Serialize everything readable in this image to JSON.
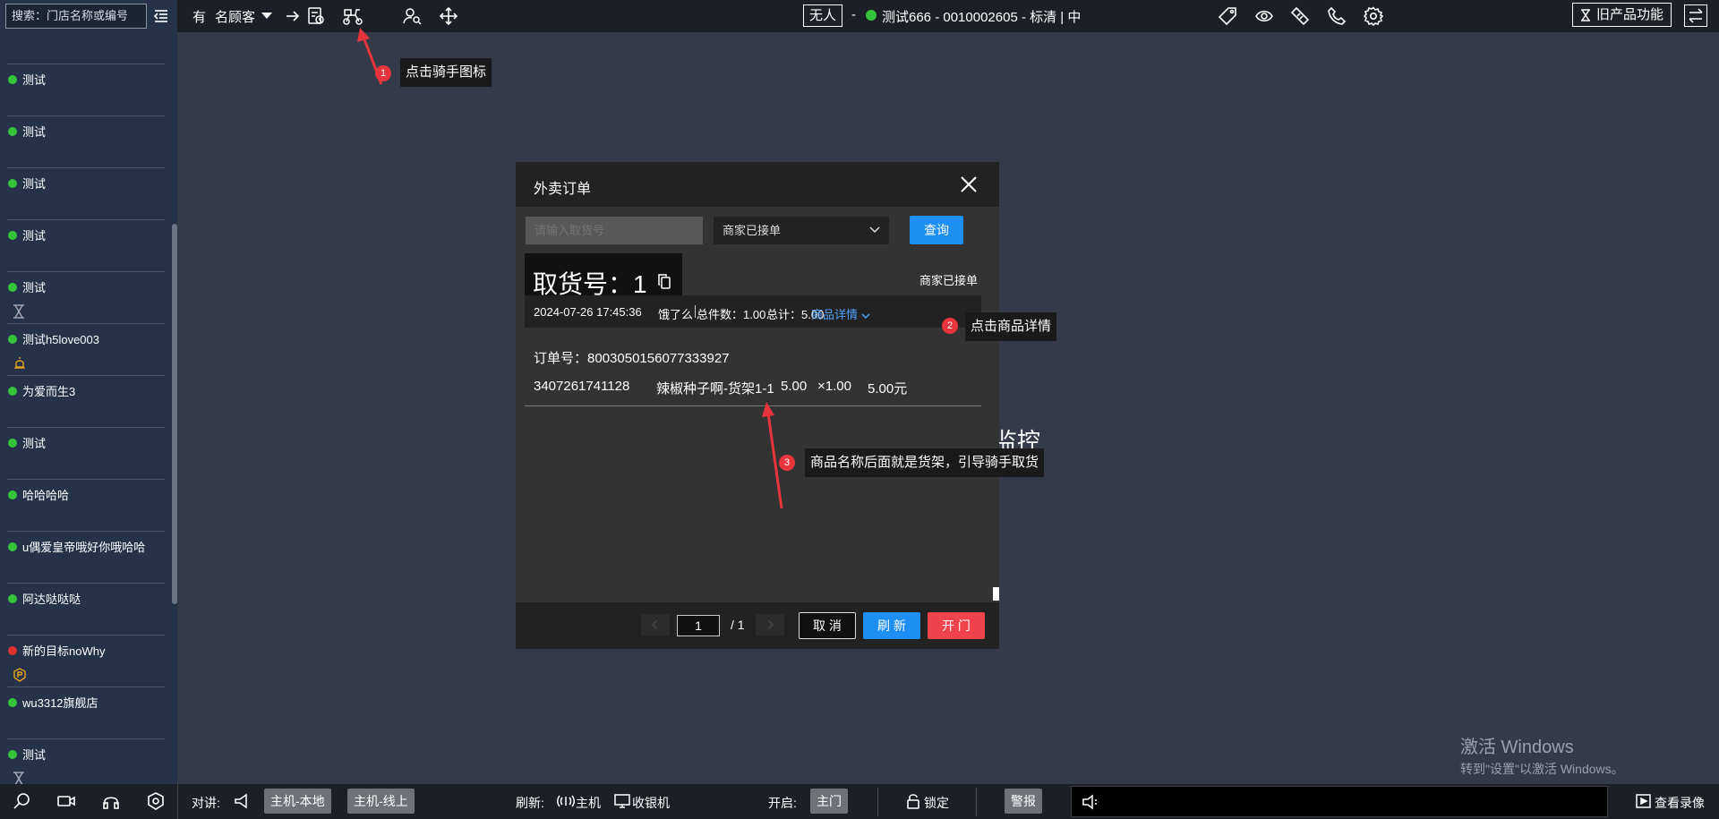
{
  "sidebar": {
    "search_placeholder": "搜索：门店名称或编号",
    "stores": [
      {
        "name": "测试",
        "status_color": "#35c33c",
        "sub_icon": ""
      },
      {
        "name": "测试",
        "status_color": "#35c33c",
        "sub_icon": ""
      },
      {
        "name": "测试",
        "status_color": "#35c33c",
        "sub_icon": ""
      },
      {
        "name": "测试",
        "status_color": "#35c33c",
        "sub_icon": ""
      },
      {
        "name": "测试",
        "status_color": "#35c33c",
        "sub_icon": "hourglass-icon"
      },
      {
        "name": "测试h5love003",
        "status_color": "#35c33c",
        "sub_icon": "alarm-icon"
      },
      {
        "name": "为爱而生3",
        "status_color": "#35c33c",
        "sub_icon": ""
      },
      {
        "name": "测试",
        "status_color": "#35c33c",
        "sub_icon": ""
      },
      {
        "name": "哈哈哈哈",
        "status_color": "#35c33c",
        "sub_icon": ""
      },
      {
        "name": "u偶爱皇帝哦好你哦哈哈",
        "status_color": "#35c33c",
        "sub_icon": ""
      },
      {
        "name": "阿达哒哒哒",
        "status_color": "#35c33c",
        "sub_icon": ""
      },
      {
        "name": "新的目标noWhy",
        "status_color": "#e0302c",
        "sub_icon": "shield-p-icon"
      },
      {
        "name": "wu3312旗舰店",
        "status_color": "#35c33c",
        "sub_icon": ""
      },
      {
        "name": "测试",
        "status_color": "#35c33c",
        "sub_icon": "hourglass-icon"
      }
    ]
  },
  "topbar": {
    "customer_prefix": "有",
    "customer_label": "名顾客",
    "status_box": "无人",
    "dash": "-",
    "camera_title": "测试666 - 0010002605 - 标清 | 中",
    "old_features": "旧产品功能"
  },
  "bottombar": {
    "intercom_label": "对讲:",
    "host_local": "主机-本地",
    "host_online": "主机-线上",
    "refresh_label": "刷新:",
    "host": "主机",
    "cashier": "收银机",
    "open_label": "开启:",
    "main_door": "主门",
    "lock": "锁定",
    "alarm": "警报",
    "view_recording": "查看录像"
  },
  "background_text": "监控",
  "activate_windows": {
    "line1": "激活 Windows",
    "line2": "转到\"设置\"以激活 Windows。"
  },
  "modal": {
    "title": "外卖订单",
    "pickup_placeholder": "请输入取货号",
    "status_filter": "商家已接单",
    "query_button": "查询",
    "order": {
      "pickup_label": "取货号：",
      "pickup_number": "1",
      "status": "商家已接单",
      "datetime": "2024-07-26 17:45:36",
      "platform": "饿了么",
      "total_items": "总件数：1.00",
      "total_amount": "总计：5.00",
      "detail_link": "商品详情",
      "order_no_label": "订单号：",
      "order_no": "8003050156077333927",
      "item": {
        "barcode": "3407261741128",
        "name": "辣椒种子啊-货架1-1",
        "price": "5.00",
        "qty": "×1.00",
        "subtotal": "5.00元"
      }
    },
    "pagination": {
      "current": "1",
      "total": "/ 1"
    },
    "cancel_button": "取 消",
    "refresh_button": "刷 新",
    "open_button": "开 门"
  },
  "annotations": [
    {
      "number": "1",
      "text": "点击骑手图标"
    },
    {
      "number": "2",
      "text": "点击商品详情"
    },
    {
      "number": "3",
      "text": "商品名称后面就是货架，引导骑手取货"
    }
  ],
  "colors": {
    "primary_blue": "#1e8ff5",
    "danger_red": "#f0434b",
    "online_green": "#35c33c"
  }
}
